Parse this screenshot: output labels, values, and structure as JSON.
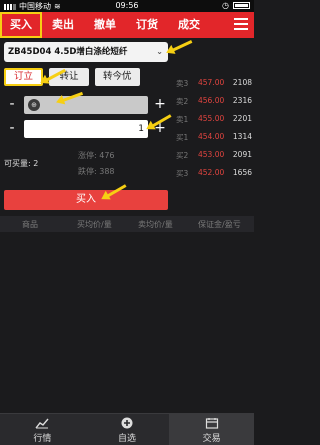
{
  "status": {
    "carrier": "中国移动",
    "time": "09:56"
  },
  "nav": {
    "tabs": [
      "买入",
      "卖出",
      "撤单",
      "订货",
      "成交"
    ]
  },
  "form": {
    "contract": "ZB45D04 4.5D增白涤纶短纤",
    "order_types": [
      "订立",
      "转让",
      "转今优"
    ],
    "price_minus": "-",
    "price_plus": "+",
    "qty_minus": "-",
    "qty_plus": "+",
    "qty_value": "1",
    "max_label": "可买量:",
    "max_value": "2",
    "limit_up_label": "涨停:",
    "limit_up_value": "476",
    "limit_down_label": "跌停:",
    "limit_down_value": "388",
    "buy_label": "买入"
  },
  "book": {
    "asks": [
      {
        "label": "卖3",
        "price": "457.00",
        "vol": "2108"
      },
      {
        "label": "卖2",
        "price": "456.00",
        "vol": "2316"
      },
      {
        "label": "卖1",
        "price": "455.00",
        "vol": "2201"
      }
    ],
    "bids": [
      {
        "label": "买1",
        "price": "454.00",
        "vol": "1314"
      },
      {
        "label": "买2",
        "price": "453.00",
        "vol": "2091"
      },
      {
        "label": "买3",
        "price": "452.00",
        "vol": "1656"
      }
    ]
  },
  "table": {
    "headers": [
      "商品",
      "买均价/量",
      "卖均价/量",
      "保证金/盈亏"
    ]
  },
  "bottom_nav": {
    "items": [
      "行情",
      "自选",
      "交易"
    ]
  }
}
